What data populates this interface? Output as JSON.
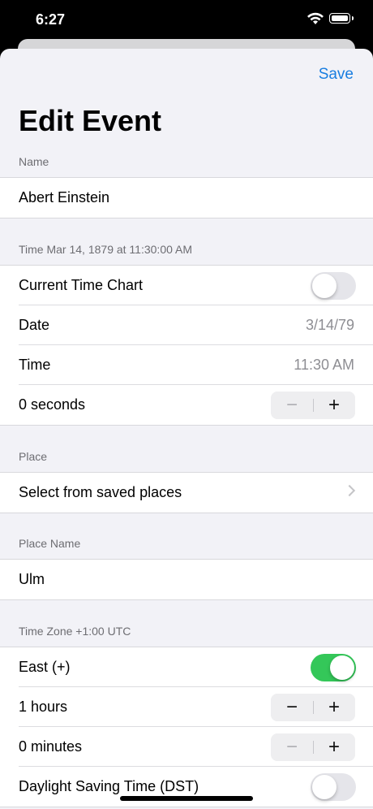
{
  "status": {
    "time": "6:27"
  },
  "nav": {
    "save_label": "Save",
    "title": "Edit Event"
  },
  "name_section": {
    "header": "Name",
    "value": "Abert Einstein"
  },
  "time_section": {
    "header": "Time Mar 14, 1879 at 11:30:00 AM",
    "current_time_chart_label": "Current Time Chart",
    "current_time_chart_on": false,
    "date_label": "Date",
    "date_value": "3/14/79",
    "time_label": "Time",
    "time_value": "11:30 AM",
    "seconds_label": "0 seconds"
  },
  "place_section": {
    "header": "Place",
    "select_label": "Select from saved places"
  },
  "place_name_section": {
    "header": "Place Name",
    "value": "Ulm"
  },
  "timezone_section": {
    "header": "Time Zone +1:00 UTC",
    "east_label": "East (+)",
    "east_on": true,
    "hours_label": "1 hours",
    "minutes_label": "0 minutes",
    "dst_label": "Daylight Saving Time (DST)",
    "dst_on": false
  },
  "stepper": {
    "minus": "−",
    "plus": "+"
  },
  "colors": {
    "accent": "#1a7ee0",
    "toggle_on": "#34c759",
    "background": "#f2f2f7"
  }
}
